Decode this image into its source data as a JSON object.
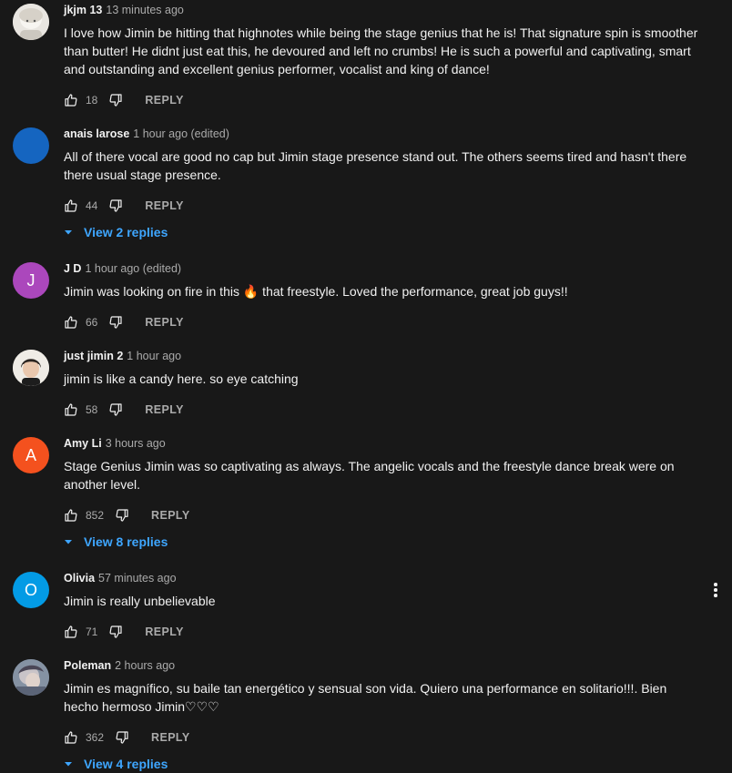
{
  "comments": [
    {
      "author": "jkjm 13",
      "time": "13 minutes ago",
      "text": "I love how Jimin be hitting that highnotes while being the stage genius that he is!  That signature spin is smoother than butter! He didnt just eat this, he devoured and left no crumbs! He is such a powerful and captivating, smart and outstanding and excellent genius performer, vocalist and king of dance!",
      "likes": "18",
      "reply_label": "REPLY",
      "avatar_type": "image",
      "avatar_color": "#d9d9d9"
    },
    {
      "author": "anais larose",
      "time": "1 hour ago (edited)",
      "text": "All of there vocal are good no cap but Jimin stage presence stand out. The others seems tired and hasn't there there usual stage presence.",
      "likes": "44",
      "reply_label": "REPLY",
      "avatar_type": "solid",
      "avatar_color": "#1565c0",
      "view_replies": "View 2 replies"
    },
    {
      "author": "J D",
      "time": "1 hour ago (edited)",
      "text": "Jimin was looking on fire in this 🔥 that freestyle. Loved the performance, great job guys!!",
      "likes": "66",
      "reply_label": "REPLY",
      "avatar_type": "letter",
      "avatar_letter": "J",
      "avatar_color": "#ab47bc"
    },
    {
      "author": "just jimin 2",
      "time": "1 hour ago",
      "text": "jimin is like a candy here. so eye catching",
      "likes": "58",
      "reply_label": "REPLY",
      "avatar_type": "image",
      "avatar_color": "#e8e4dc"
    },
    {
      "author": "Amy Li",
      "time": "3 hours ago",
      "text": "Stage Genius Jimin was so captivating as always. The angelic vocals and the freestyle dance break were on another level.",
      "likes": "852",
      "reply_label": "REPLY",
      "avatar_type": "letter",
      "avatar_letter": "A",
      "avatar_color": "#f4511e",
      "view_replies": "View 8 replies"
    },
    {
      "author": "Olivia",
      "time": "57 minutes ago",
      "text": "Jimin is really unbelievable",
      "likes": "71",
      "reply_label": "REPLY",
      "avatar_type": "letter",
      "avatar_letter": "O",
      "avatar_color": "#039be5",
      "has_menu": true
    },
    {
      "author": "Poleman",
      "time": "2 hours ago",
      "text": "Jimin es magnífico, su baile tan energético y sensual son vida. Quiero una performance en solitario!!!. Bien hecho hermoso Jimin♡♡♡",
      "likes": "362",
      "reply_label": "REPLY",
      "avatar_type": "image",
      "avatar_color": "#6d7a8c",
      "view_replies": "View 4 replies"
    }
  ],
  "icons": {
    "like": "thumbs-up-icon",
    "dislike": "thumbs-down-icon",
    "chevron": "chevron-down-icon",
    "menu": "more-vert-icon"
  },
  "colors": {
    "background": "#181818",
    "text": "#f1f1f1",
    "secondary": "#aaaaaa",
    "link": "#3ea6ff"
  }
}
